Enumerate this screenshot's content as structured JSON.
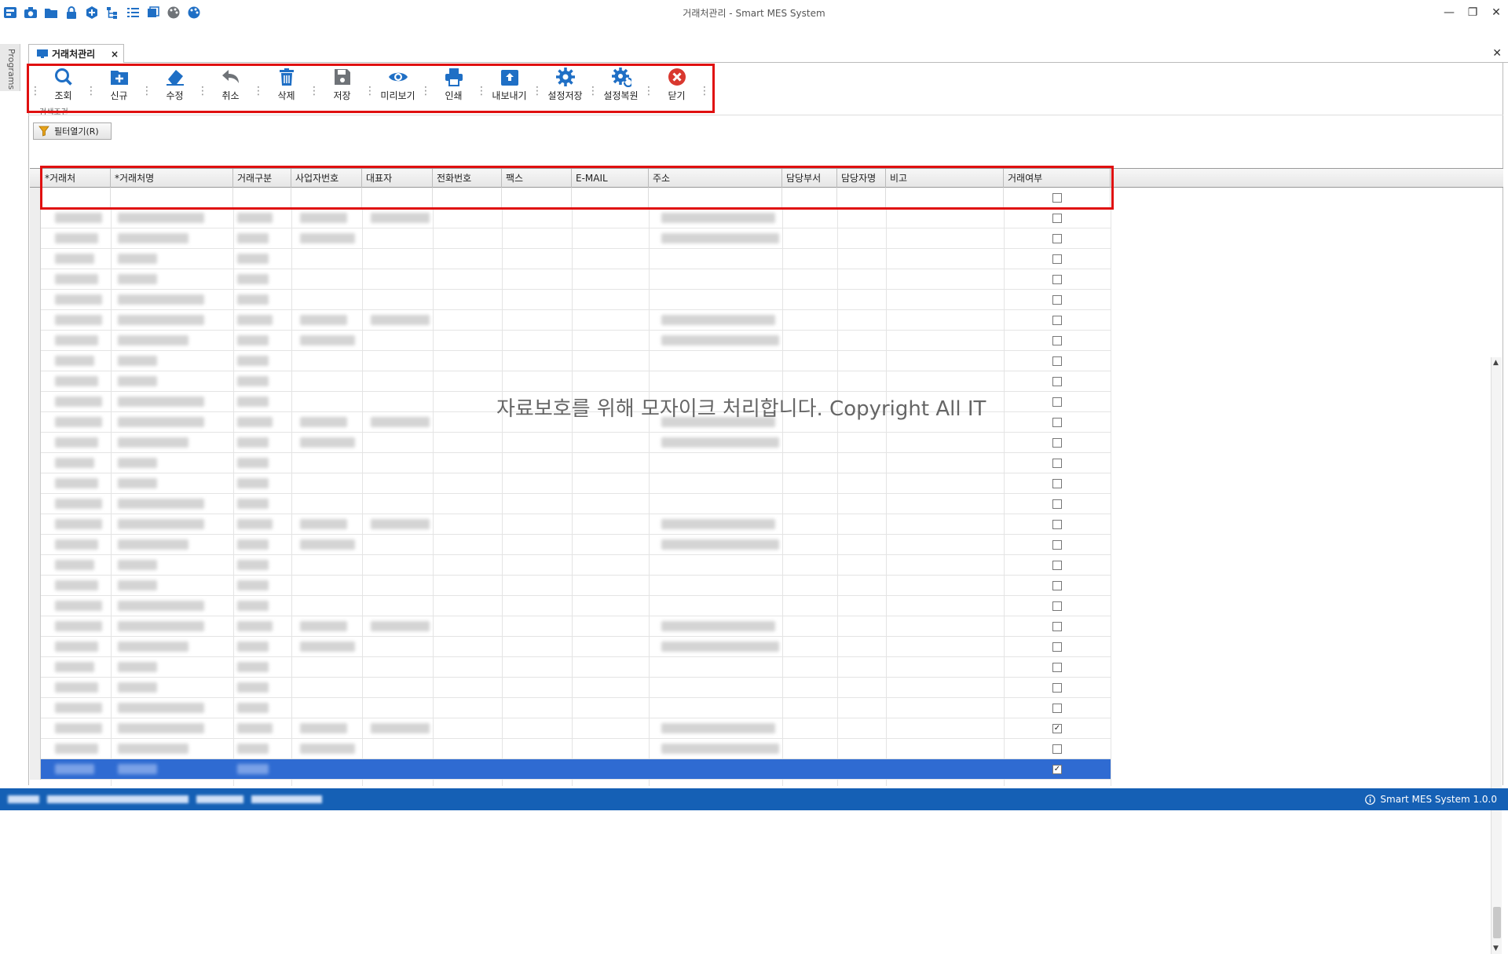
{
  "window": {
    "title": "거래처관리 - Smart MES System"
  },
  "title_icons": [
    "camera-icon",
    "folder-icon",
    "lock-icon",
    "add-circle-icon",
    "tree-icon",
    "list-icon",
    "window-icon",
    "palette-icon",
    "color-icon"
  ],
  "sidebar": {
    "label": "Programs"
  },
  "tab": {
    "label": "거래처관리",
    "close": "×"
  },
  "toolbar": {
    "buttons": [
      {
        "label": "조회",
        "icon": "search-icon"
      },
      {
        "label": "신규",
        "icon": "new-icon"
      },
      {
        "label": "수정",
        "icon": "edit-icon"
      },
      {
        "label": "취소",
        "icon": "undo-icon"
      },
      {
        "label": "삭제",
        "icon": "delete-icon"
      },
      {
        "label": "저장",
        "icon": "save-icon"
      },
      {
        "label": "미리보기",
        "icon": "preview-icon"
      },
      {
        "label": "인쇄",
        "icon": "print-icon"
      },
      {
        "label": "내보내기",
        "icon": "export-icon"
      },
      {
        "label": "설정저장",
        "icon": "gear-save-icon"
      },
      {
        "label": "설정복원",
        "icon": "gear-restore-icon"
      },
      {
        "label": "닫기",
        "icon": "close-icon"
      }
    ],
    "search_caption": "검색조건"
  },
  "filter": {
    "button_label": "필터열기(R)"
  },
  "grid": {
    "columns": [
      "*거래처",
      "*거래처명",
      "거래구분",
      "사업자번호",
      "대표자",
      "전화번호",
      "팩스",
      "E-MAIL",
      "주소",
      "담당부서",
      "담당자명",
      "비고",
      "거래여부"
    ],
    "row_checks": [
      false,
      false,
      false,
      false,
      false,
      false,
      false,
      false,
      false,
      false,
      false,
      false,
      false,
      false,
      false,
      false,
      false,
      false,
      false,
      false,
      false,
      false,
      false,
      false,
      false,
      true,
      false,
      true
    ]
  },
  "watermark": "자료보호를 위해 모자이크 처리합니다. Copyright All IT",
  "status": {
    "app_version": "Smart MES System 1.0.0"
  },
  "colors": {
    "accent": "#1560b5",
    "highlight": "#e01010",
    "selected_row": "#2f6bd2",
    "icon_blue": "#1f6fc5",
    "icon_gray": "#6f7378",
    "icon_red": "#d9382f"
  }
}
